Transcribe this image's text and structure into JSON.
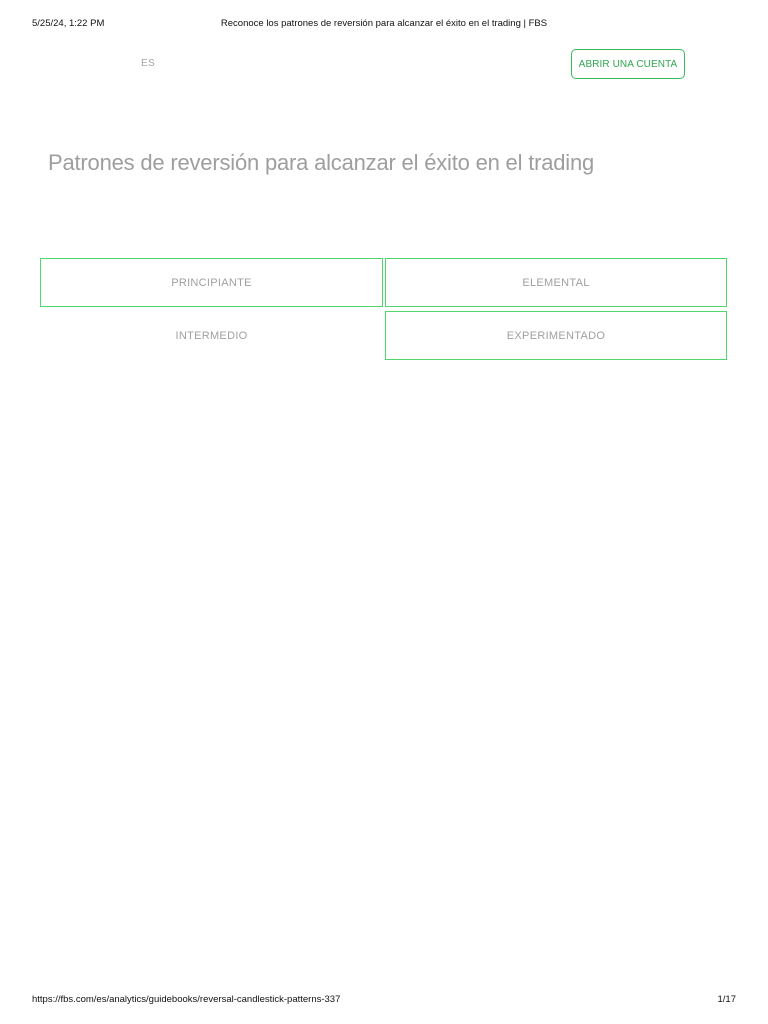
{
  "print_header": {
    "datetime": "5/25/24, 1:22 PM",
    "document_title": "Reconoce los patrones de reversión para alcanzar el éxito en el trading | FBS"
  },
  "site_header": {
    "language": "ES",
    "cta_label": "ABRIR UNA CUENTA"
  },
  "main": {
    "title": "Patrones de reversión para alcanzar el éxito en el trading",
    "levels": [
      {
        "label": "PRINCIPIANTE"
      },
      {
        "label": "ELEMENTAL"
      },
      {
        "label": "INTERMEDIO"
      },
      {
        "label": "EXPERIMENTADO"
      }
    ]
  },
  "print_footer": {
    "url": "https://fbs.com/es/analytics/guidebooks/reversal-candlestick-patterns-337",
    "page_indicator": "1/17"
  },
  "colors": {
    "accent_green": "#3ab75c",
    "cell_border_green": "#4fd66c",
    "muted_text": "#a0a0a0"
  }
}
